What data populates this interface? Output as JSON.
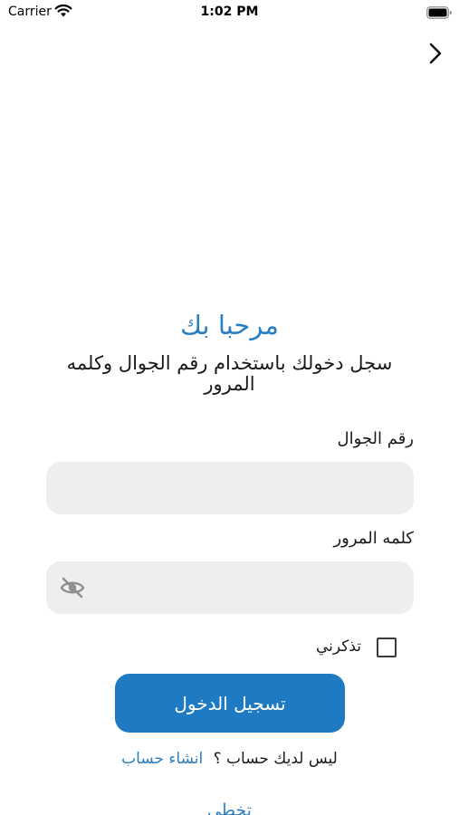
{
  "status_bar": {
    "carrier": "Carrier",
    "time": "1:02 PM"
  },
  "nav": {
    "next_icon": "chevron-right-icon"
  },
  "welcome": {
    "title": "مرحبا بك",
    "subtitle": "سجل دخولك باستخدام رقم الجوال وكلمه المرور"
  },
  "form": {
    "phone_label": "رقم الجوال",
    "phone_value": "",
    "password_label": "كلمه المرور",
    "password_value": "",
    "password_toggle_icon": "eye-slash-icon",
    "remember_label": "تذكرني",
    "remember_checked": false,
    "login_label": "تسجيل الدخول"
  },
  "signup": {
    "prompt": "ليس لديك حساب ؟",
    "link": "انشاء حساب"
  },
  "skip": {
    "label": "تخطي"
  },
  "colors": {
    "accent": "#1f7ac4",
    "link": "#2a7ec2",
    "input_bg": "#efeeed"
  }
}
